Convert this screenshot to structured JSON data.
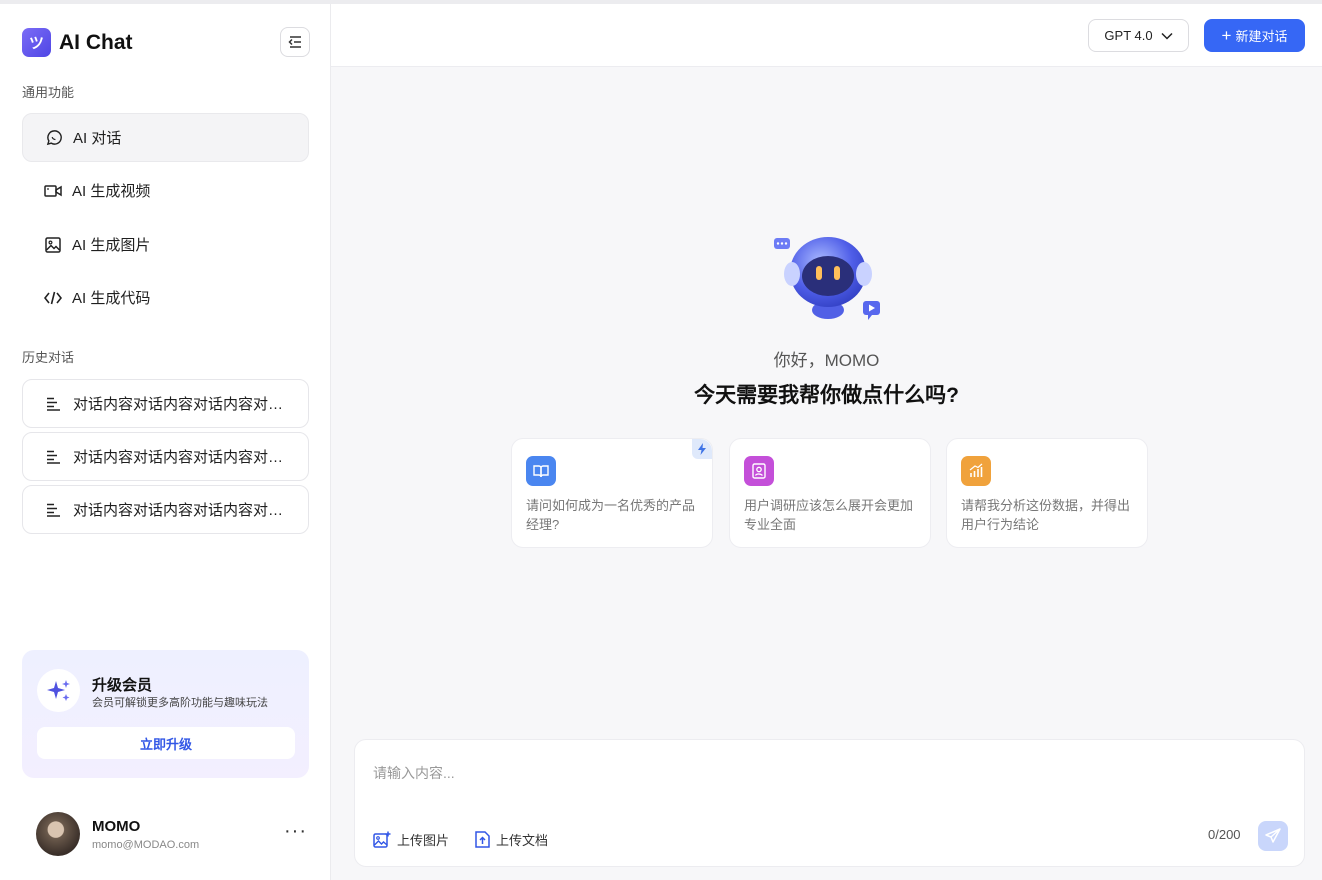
{
  "app": {
    "title": "AI Chat",
    "logo_glyph": "ツ"
  },
  "sidebar": {
    "section_general": "通用功能",
    "items": [
      {
        "label": "AI 对话",
        "icon": "chat-bubble-icon",
        "active": true
      },
      {
        "label": "AI 生成视频",
        "icon": "video-camera-icon",
        "active": false
      },
      {
        "label": "AI 生成图片",
        "icon": "image-icon",
        "active": false
      },
      {
        "label": "AI 生成代码",
        "icon": "code-icon",
        "active": false
      }
    ],
    "section_history": "历史对话",
    "history": [
      {
        "label": "对话内容对话内容对话内容对话内容对话内容"
      },
      {
        "label": "对话内容对话内容对话内容对话内容对话内容"
      },
      {
        "label": "对话内容对话内容对话内容对话内容对话内容"
      }
    ]
  },
  "upgrade": {
    "title": "升级会员",
    "subtitle": "会员可解锁更多高阶功能与趣味玩法",
    "button": "立即升级"
  },
  "user": {
    "name": "MOMO",
    "email": "momo@MODAO.com",
    "more": "···"
  },
  "header": {
    "model": "GPT 4.0",
    "new_chat": "新建对话"
  },
  "welcome": {
    "greeting": "你好，MOMO",
    "question": "今天需要我帮你做点什么吗?"
  },
  "suggestions": [
    {
      "text": "请问如何成为一名优秀的产品经理?",
      "icon": "book-icon",
      "color": "#3b82f6"
    },
    {
      "text": "用户调研应该怎么展开会更加专业全面",
      "icon": "profile-card-icon",
      "color": "#c44fd9"
    },
    {
      "text": "请帮我分析这份数据，并得出用户行为结论",
      "icon": "bar-chart-icon",
      "color": "#f0a23c"
    }
  ],
  "composer": {
    "placeholder": "请输入内容...",
    "upload_image": "上传图片",
    "upload_doc": "上传文档",
    "counter": "0/200"
  },
  "colors": {
    "primary": "#3667f5",
    "send_disabled": "#c9d6fb"
  }
}
